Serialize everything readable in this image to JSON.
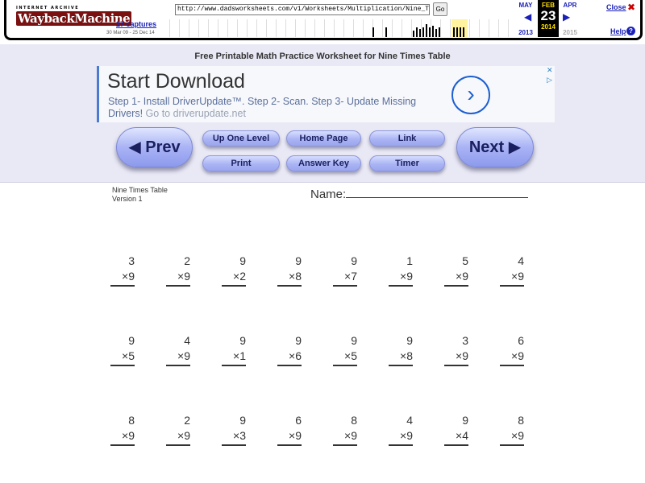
{
  "wayback": {
    "logo_small": "INTERNET ARCHIVE",
    "logo_big": "WaybackMachine",
    "captures": "27 captures",
    "range": "30 Mar 09 - 25 Dec 14",
    "url": "http://www.dadsworksheets.com/v1/Worksheets/Multiplication/Nine_Times_Table_",
    "go": "Go",
    "prev_month": "MAY",
    "cur_month": "FEB",
    "next_month": "APR",
    "day": "23",
    "prev_year": "2013",
    "cur_year": "2014",
    "next_year": "2015",
    "close": "Close",
    "help": "Help"
  },
  "page": {
    "title": "Free Printable Math Practice Worksheet for Nine Times Table"
  },
  "ad": {
    "title": "Start Download",
    "body": "Step 1- Install DriverUpdate™. Step 2- Scan. Step 3- Update Missing Drivers!",
    "link": "Go to driverupdate.net",
    "close_icon": "close-icon",
    "info_icon": "adchoices-icon"
  },
  "nav": {
    "prev": "◀ Prev",
    "next": "Next ▶",
    "up_one_level": "Up One Level",
    "home_page": "Home Page",
    "link": "Link",
    "print": "Print",
    "answer_key": "Answer Key",
    "timer": "Timer"
  },
  "worksheet": {
    "title_line1": "Nine Times Table",
    "title_line2": "Version 1",
    "name_label": "Name:",
    "rows": [
      [
        [
          "3",
          "×9"
        ],
        [
          "2",
          "×9"
        ],
        [
          "9",
          "×2"
        ],
        [
          "9",
          "×8"
        ],
        [
          "9",
          "×7"
        ],
        [
          "1",
          "×9"
        ],
        [
          "5",
          "×9"
        ],
        [
          "4",
          "×9"
        ]
      ],
      [
        [
          "9",
          "×5"
        ],
        [
          "4",
          "×9"
        ],
        [
          "9",
          "×1"
        ],
        [
          "9",
          "×6"
        ],
        [
          "9",
          "×5"
        ],
        [
          "9",
          "×8"
        ],
        [
          "3",
          "×9"
        ],
        [
          "6",
          "×9"
        ]
      ],
      [
        [
          "8",
          "×9"
        ],
        [
          "2",
          "×9"
        ],
        [
          "9",
          "×3"
        ],
        [
          "6",
          "×9"
        ],
        [
          "8",
          "×9"
        ],
        [
          "4",
          "×9"
        ],
        [
          "9",
          "×4"
        ],
        [
          "8",
          "×9"
        ]
      ]
    ]
  }
}
